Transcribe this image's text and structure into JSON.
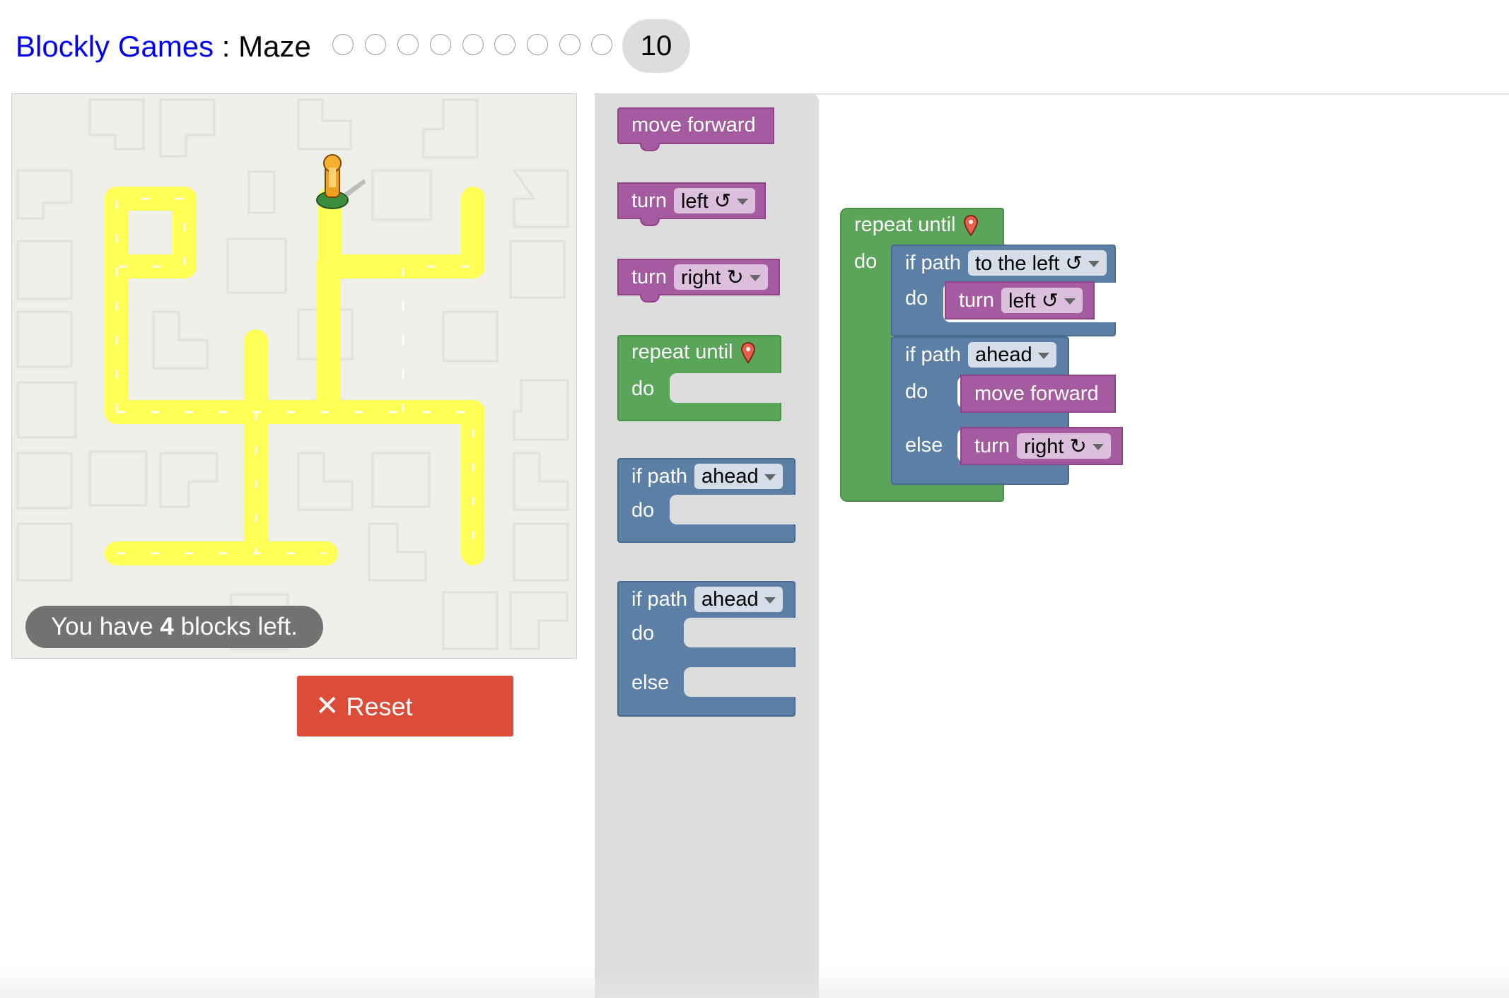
{
  "header": {
    "app_link": "Blockly Games",
    "separator": " : ",
    "page": "Maze",
    "current_level": "10",
    "level_count": 10
  },
  "maze": {
    "status_prefix": "You have ",
    "blocks_left": "4",
    "status_suffix": " blocks left.",
    "icons": [
      "pegman-icon",
      "path-tile"
    ]
  },
  "controls": {
    "reset_icon": "✕",
    "reset_label": "Reset"
  },
  "toolbox": {
    "move_forward": "move forward",
    "turn": "turn",
    "left": "left ↺",
    "right": "right ↻",
    "repeat_until": "repeat until",
    "do": "do",
    "else": "else",
    "if_path": "if path",
    "ahead": "ahead"
  },
  "workspace": {
    "repeat_until": "repeat until",
    "do": "do",
    "if_path": "if path",
    "to_the_left": "to the left ↺",
    "turn": "turn",
    "left": "left ↺",
    "ahead": "ahead",
    "move_forward": "move forward",
    "else": "else",
    "right": "right ↻"
  },
  "colors": {
    "motion": "#a55b9f",
    "logic": "#5c80a5",
    "loop": "#5ba55b",
    "path": "#ffff55",
    "reset": "#dd4b39",
    "link": "#0000ee"
  }
}
